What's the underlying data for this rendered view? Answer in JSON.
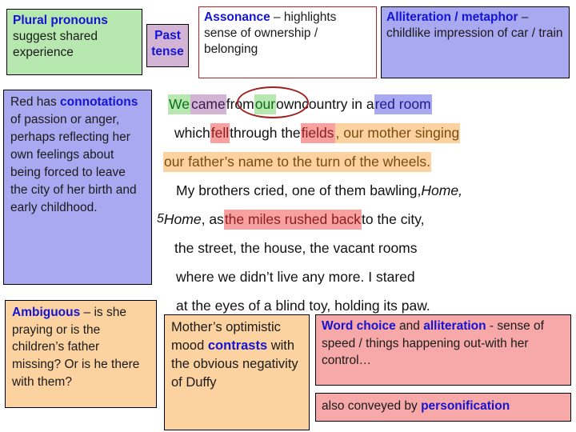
{
  "annotations": {
    "plural_pronouns": {
      "keyword": "Plural pronouns",
      "rest": " suggest shared experience",
      "color": "#b7e8b0"
    },
    "past_tense": {
      "line1": "Past",
      "line2": "tense",
      "color": "#d4b4d4"
    },
    "assonance": {
      "keyword": "Assonance",
      "rest": " – highlights sense of ownership / belonging",
      "color": "#ffffff",
      "border": "#b52424"
    },
    "alliteration_metaphor": {
      "keyword": "Alliteration / metaphor",
      "rest": " – childlike impression of car / train",
      "color": "#a9a9f2"
    },
    "red_connotations": {
      "pre": "Red has ",
      "keyword": "connotations",
      "rest": " of passion or anger, perhaps reflecting her own feelings about being forced to leave the city of her birth and early childhood.",
      "color": "#a9a9f2"
    },
    "ambiguous": {
      "keyword": "Ambiguous",
      "rest": " – is she praying or is the children’s father missing? Or is he there with them?",
      "color": "#fcd3a0"
    },
    "mother_mood": {
      "pre": "Mother’s optimistic mood ",
      "keyword": "contrasts",
      "rest": " with the obvious negativity of Duffy",
      "color": "#fcd3a0"
    },
    "word_choice": {
      "keyword1": "Word choice",
      "mid": " and ",
      "keyword2": "alliteration",
      "rest": " - sense of speed / things happening out-with her control…",
      "color": "#f7a8a8"
    },
    "personification": {
      "pre": "also conveyed by ",
      "keyword": "personification",
      "color": "#f7a8a8"
    }
  },
  "poem": {
    "line_number": "5",
    "lines": [
      {
        "id": "l1",
        "segments": [
          {
            "text": "We",
            "highlight": "green"
          },
          {
            "text": " ",
            "highlight": "none"
          },
          {
            "text": "came",
            "highlight": "purple"
          },
          {
            "text": " from ",
            "highlight": "none"
          },
          {
            "text": "our",
            "highlight": "green"
          },
          {
            "text": " own",
            "highlight": "none"
          },
          {
            "text": " country in a ",
            "highlight": "none"
          },
          {
            "text": "red room",
            "highlight": "blue"
          }
        ]
      },
      {
        "id": "l2",
        "segments": [
          {
            "text": "which ",
            "highlight": "none"
          },
          {
            "text": "fell",
            "highlight": "pink"
          },
          {
            "text": " through the ",
            "highlight": "none"
          },
          {
            "text": "fields",
            "highlight": "pink"
          },
          {
            "text": ", our mother singing",
            "highlight": "orange"
          }
        ]
      },
      {
        "id": "l3",
        "segments": [
          {
            "text": "our father’s name to the turn of the wheels.",
            "highlight": "orange"
          }
        ]
      },
      {
        "id": "l4",
        "segments": [
          {
            "text": "My brothers cried, one of them bawling, ",
            "highlight": "none"
          },
          {
            "text": "Home,",
            "highlight": "none",
            "italic": true
          }
        ]
      },
      {
        "id": "l5",
        "segments": [
          {
            "text": "Home",
            "highlight": "none",
            "italic": true
          },
          {
            "text": ", as ",
            "highlight": "none"
          },
          {
            "text": "the miles rushed back",
            "highlight": "pink"
          },
          {
            "text": " to the city,",
            "highlight": "none"
          }
        ]
      },
      {
        "id": "l6",
        "segments": [
          {
            "text": "the street, the house, the vacant rooms",
            "highlight": "none"
          }
        ]
      },
      {
        "id": "l7",
        "segments": [
          {
            "text": "where we didn’t live any more. I stared",
            "highlight": "none"
          }
        ]
      },
      {
        "id": "l8",
        "segments": [
          {
            "text": "at the eyes of a blind toy, holding its paw.",
            "highlight": "none"
          }
        ]
      }
    ],
    "ellipse_annotation": "our own"
  },
  "colors": {
    "keyword_blue": "#1414d2",
    "highlight_green": "#b7e8b0",
    "highlight_purple": "#d4b4d4",
    "highlight_blue": "#a9a9f2",
    "highlight_pink": "#f7a1a1",
    "highlight_orange": "#fcd3a0",
    "ellipse_red": "#a02020"
  }
}
